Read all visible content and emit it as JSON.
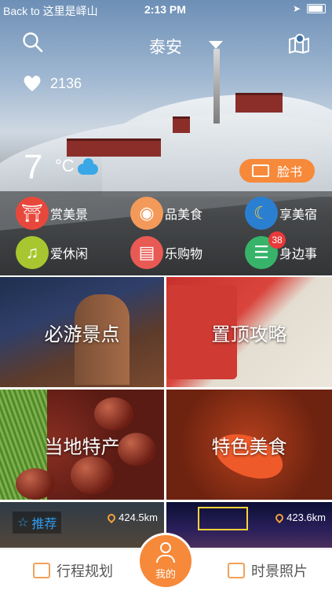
{
  "status_bar": {
    "back_label": "Back to 这里是峄山",
    "time": "2:13 PM"
  },
  "header": {
    "city": "泰安",
    "likes": "2136"
  },
  "weather": {
    "temp": "7",
    "unit": "°C",
    "icon": "cloud-icon"
  },
  "face_button": {
    "label": "脸书"
  },
  "categories": [
    {
      "label": "赏美景",
      "color": "#e8483b",
      "icon": "temple-icon"
    },
    {
      "label": "品美食",
      "color": "#f39a5a",
      "icon": "egg-icon"
    },
    {
      "label": "享美宿",
      "color": "#2a7fd1",
      "icon": "moon-house-icon"
    },
    {
      "label": "爱休闲",
      "color": "#a8c62f",
      "icon": "music-icon"
    },
    {
      "label": "乐购物",
      "color": "#e95a54",
      "icon": "basket-icon"
    },
    {
      "label": "身边事",
      "color": "#37b46a",
      "icon": "chat-icon",
      "badge": "38"
    }
  ],
  "tiles": [
    {
      "label": "必游景点"
    },
    {
      "label": "置顶攻略"
    },
    {
      "label": "当地特产"
    },
    {
      "label": "特色美食"
    }
  ],
  "recommend": {
    "tag": "推荐",
    "items": [
      {
        "distance": "424.5km"
      },
      {
        "distance": "423.6km"
      }
    ]
  },
  "tabbar": {
    "left": "行程规划",
    "center": "我的",
    "right": "时景照片"
  },
  "colors": {
    "accent": "#f6893a"
  }
}
